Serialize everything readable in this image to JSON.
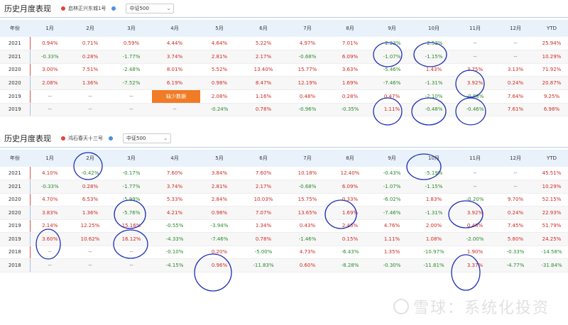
{
  "colors": {
    "positive": "#d0281f",
    "negative": "#2a8a2a",
    "header_bg": "#e9f2fb",
    "series_dot": "#e0443a",
    "index_dot": "#4a90e2",
    "badge": "#f07c26",
    "annotation": "#1c2fb5"
  },
  "panels": [
    {
      "title": "历史月度表现",
      "legend_fund": "启林正兴东城1号",
      "legend_index": "中证500",
      "select_value": "中证500",
      "columns": [
        "年份",
        "1月",
        "2月",
        "3月",
        "4月",
        "5月",
        "6月",
        "7月",
        "8月",
        "9月",
        "10月",
        "11月",
        "12月",
        "YTD"
      ],
      "rows": [
        [
          "2021",
          "0.94%",
          "0.71%",
          "0.59%",
          "4.44%",
          "4.64%",
          "5.22%",
          "4.97%",
          "7.01%",
          "-2.23%",
          "-2.52%",
          "--",
          "--",
          "25.94%"
        ],
        [
          "2021",
          "-0.33%",
          "0.28%",
          "-1.77%",
          "3.74%",
          "2.81%",
          "2.17%",
          "-0.68%",
          "6.09%",
          "-1.07%",
          "-1.15%",
          "--",
          "--",
          "10.29%"
        ],
        [
          "2020",
          "3.00%",
          "7.51%",
          "-2.48%",
          "8.01%",
          "5.52%",
          "13.40%",
          "15.77%",
          "3.63%",
          "-5.46%",
          "1.43%",
          "3.75%",
          "3.13%",
          "71.92%"
        ],
        [
          "2020",
          "2.08%",
          "1.36%",
          "-7.52%",
          "6.19%",
          "0.98%",
          "8.47%",
          "12.19%",
          "1.69%",
          "-7.46%",
          "-1.31%",
          "3.92%",
          "0.24%",
          "20.87%"
        ],
        [
          "2019",
          "--",
          "--",
          "--",
          "缺少数据",
          "2.08%",
          "1.16%",
          "0.48%",
          "0.28%",
          "0.47%",
          "-2.10%",
          "-0.88%",
          "7.64%",
          "9.25%"
        ],
        [
          "2019",
          "--",
          "--",
          "--",
          "--",
          "-0.24%",
          "0.78%",
          "-0.96%",
          "-0.35%",
          "1.11%",
          "-0.48%",
          "-0.46%",
          "7.61%",
          "6.98%"
        ]
      ]
    },
    {
      "title": "历史月度表现",
      "legend_fund": "鸿石春天十三号",
      "legend_index": "中证500",
      "select_value": "中证500",
      "columns": [
        "年份",
        "1月",
        "2月",
        "3月",
        "4月",
        "5月",
        "6月",
        "7月",
        "8月",
        "9月",
        "10月",
        "11月",
        "12月",
        "YTD"
      ],
      "rows": [
        [
          "2021",
          "4.10%",
          "-0.42%",
          "-0.17%",
          "7.60%",
          "3.84%",
          "7.60%",
          "10.18%",
          "12.40%",
          "-0.43%",
          "-5.19%",
          "--",
          "--",
          "45.51%"
        ],
        [
          "2021",
          "-0.33%",
          "0.28%",
          "-1.77%",
          "3.74%",
          "2.81%",
          "2.17%",
          "-0.68%",
          "6.09%",
          "-1.07%",
          "-1.15%",
          "--",
          "--",
          "10.29%"
        ],
        [
          "2020",
          "4.70%",
          "6.53%",
          "-5.99%",
          "5.33%",
          "2.84%",
          "10.03%",
          "15.75%",
          "0.33%",
          "-6.02%",
          "1.83%",
          "-0.20%",
          "9.70%",
          "52.15%"
        ],
        [
          "2020",
          "3.83%",
          "1.36%",
          "-5.76%",
          "4.21%",
          "0.98%",
          "7.07%",
          "13.65%",
          "1.69%",
          "-7.46%",
          "-1.31%",
          "3.92%",
          "0.24%",
          "22.93%"
        ],
        [
          "2019",
          "2.14%",
          "12.25%",
          "15.16%",
          "-0.55%",
          "-3.94%",
          "1.34%",
          "0.43%",
          "2.45%",
          "4.76%",
          "2.00%",
          "0.48%",
          "7.45%",
          "51.79%"
        ],
        [
          "2019",
          "3.60%",
          "10.62%",
          "16.12%",
          "-4.33%",
          "-7.46%",
          "0.78%",
          "-1.46%",
          "0.15%",
          "1.11%",
          "1.08%",
          "-2.00%",
          "5.80%",
          "24.25%"
        ],
        [
          "2018",
          "--",
          "--",
          "--",
          "-0.10%",
          "0.20%",
          "-5.00%",
          "4.73%",
          "-6.43%",
          "1.35%",
          "-10.97%",
          "1.90%",
          "-0.33%",
          "-14.58%"
        ],
        [
          "2018",
          "--",
          "--",
          "--",
          "-4.15%",
          "0.96%",
          "-11.83%",
          "0.60%",
          "-8.28%",
          "-0.30%",
          "-11.81%",
          "3.37%",
          "-4.77%",
          "-31.84%"
        ]
      ]
    }
  ],
  "watermark": "雪球：系统化投资"
}
